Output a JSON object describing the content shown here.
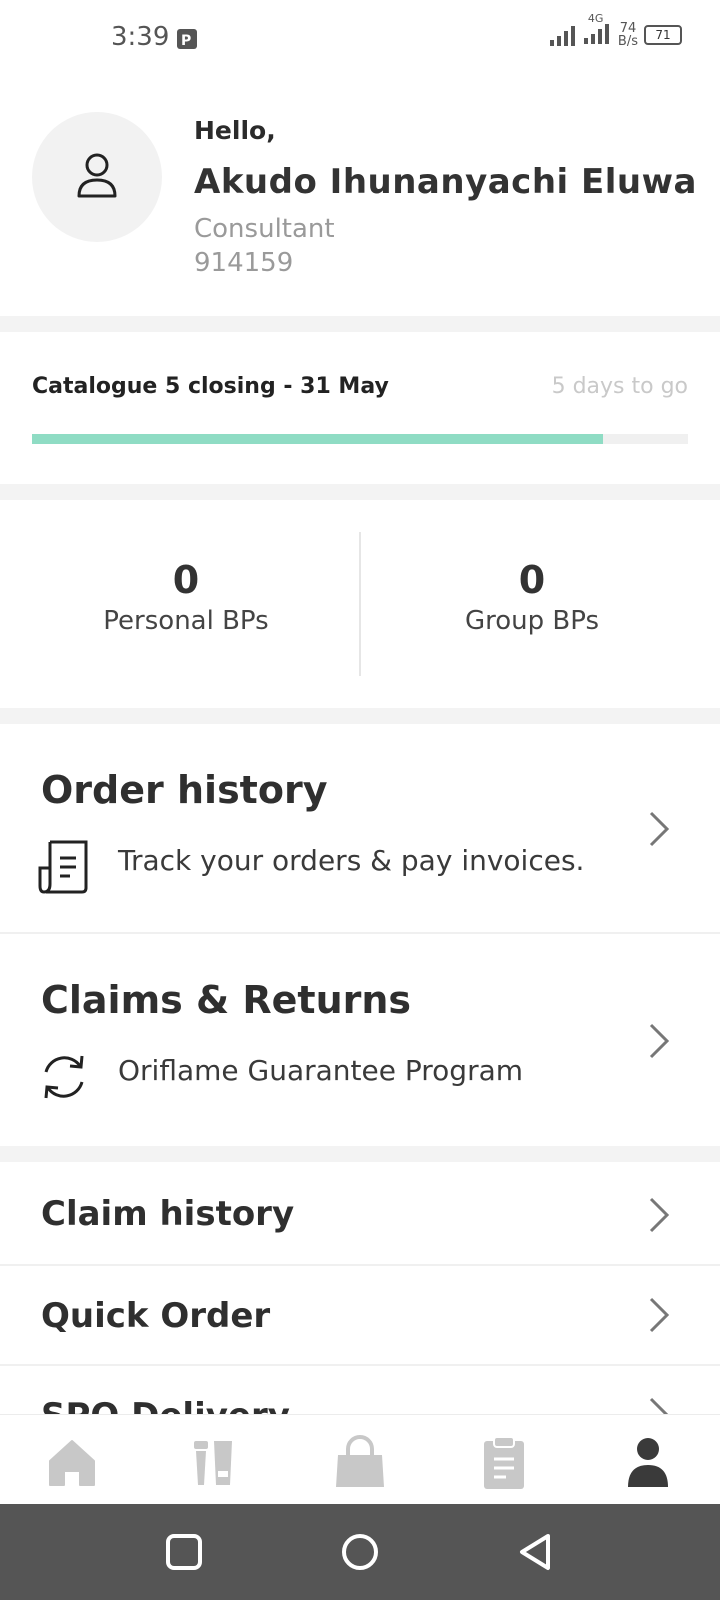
{
  "status_bar": {
    "time": "3:39",
    "network": "4G",
    "speed_value": "74",
    "speed_unit": "B/s",
    "battery": "71"
  },
  "profile": {
    "greeting": "Hello,",
    "name": "Akudo Ihunanyachi Eluwa",
    "role": "Consultant",
    "id": "914159"
  },
  "catalogue": {
    "label": "Catalogue 5 closing - 31 May",
    "days_left": "5 days to go",
    "progress_fraction": 0.87,
    "progress_color": "#8fdcc4"
  },
  "bps": {
    "personal_value": "0",
    "personal_label": "Personal BPs",
    "group_value": "0",
    "group_label": "Group BPs"
  },
  "order_history": {
    "title": "Order history",
    "subtitle": "Track your orders & pay invoices.",
    "icon": "receipt-icon"
  },
  "claims_returns": {
    "title": "Claims & Returns",
    "subtitle": "Oriflame Guarantee Program",
    "icon": "refresh-icon"
  },
  "list": [
    {
      "label": "Claim history"
    },
    {
      "label": "Quick Order"
    },
    {
      "label": "SPO Delivery"
    }
  ],
  "bottom_nav": [
    {
      "icon": "home-icon",
      "active": false
    },
    {
      "icon": "products-icon",
      "active": false
    },
    {
      "icon": "bag-icon",
      "active": false
    },
    {
      "icon": "clipboard-icon",
      "active": false
    },
    {
      "icon": "profile-icon",
      "active": true
    }
  ],
  "colors": {
    "inactive_icon": "#c8c8c8",
    "active_icon": "#3a3a3a",
    "system_nav": "#555555"
  }
}
